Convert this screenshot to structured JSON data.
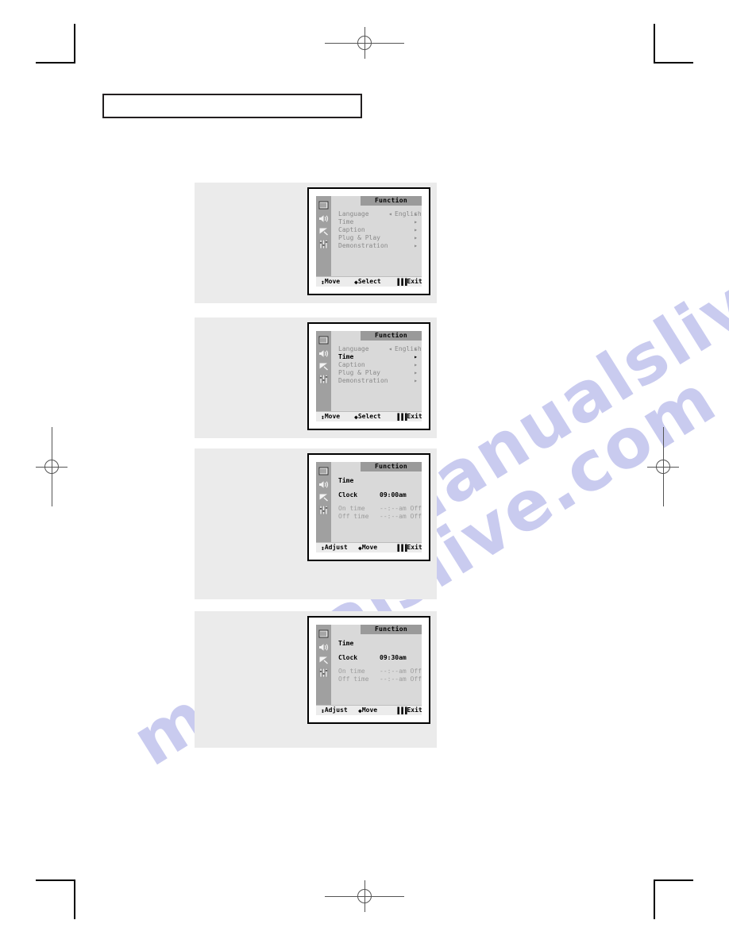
{
  "page": {
    "caption_box_text": "",
    "watermark": "manualslive.com"
  },
  "icons": {
    "picture": "picture-icon",
    "sound": "sound-speaker-icon",
    "channel": "channel-antenna-icon",
    "function": "function-sliders-icon"
  },
  "figures": [
    {
      "id": "fig-1",
      "title": "Function",
      "rows": [
        {
          "label": "Language",
          "value": "English",
          "left_arrow": "◂",
          "right_arrow": "▸",
          "state": "normal"
        },
        {
          "label": "Time",
          "value": "",
          "left_arrow": "",
          "right_arrow": "▸",
          "state": "normal"
        },
        {
          "label": "Caption",
          "value": "",
          "left_arrow": "",
          "right_arrow": "▸",
          "state": "normal"
        },
        {
          "label": "Plug & Play",
          "value": "",
          "left_arrow": "",
          "right_arrow": "▸",
          "state": "normal"
        },
        {
          "label": "Demonstration",
          "value": "",
          "left_arrow": "",
          "right_arrow": "▸",
          "state": "normal"
        }
      ],
      "footer": [
        {
          "glyph": "↕",
          "label": "Move"
        },
        {
          "glyph": "◆",
          "label": "Select"
        },
        {
          "glyph": "▐▐▐",
          "label": "Exit"
        }
      ]
    },
    {
      "id": "fig-2",
      "title": "Function",
      "rows": [
        {
          "label": "Language",
          "value": "English",
          "left_arrow": "◂",
          "right_arrow": "▸",
          "state": "normal"
        },
        {
          "label": "Time",
          "value": "",
          "left_arrow": "",
          "right_arrow": "▸",
          "state": "active"
        },
        {
          "label": "Caption",
          "value": "",
          "left_arrow": "",
          "right_arrow": "▸",
          "state": "normal"
        },
        {
          "label": "Plug & Play",
          "value": "",
          "left_arrow": "",
          "right_arrow": "▸",
          "state": "normal"
        },
        {
          "label": "Demonstration",
          "value": "",
          "left_arrow": "",
          "right_arrow": "▸",
          "state": "normal"
        }
      ],
      "footer": [
        {
          "glyph": "↕",
          "label": "Move"
        },
        {
          "glyph": "◆",
          "label": "Select"
        },
        {
          "glyph": "▐▐▐",
          "label": "Exit"
        }
      ]
    },
    {
      "id": "fig-3",
      "title": "Function",
      "rows": [
        {
          "label": "Time",
          "value": "",
          "left_arrow": "",
          "right_arrow": "",
          "state": "active"
        },
        {
          "label": "Clock",
          "value": "09:00am",
          "left_arrow": "",
          "right_arrow": "",
          "state": "active"
        },
        {
          "label": "On time",
          "value": "--:--am Off",
          "left_arrow": "",
          "right_arrow": "",
          "state": "dim"
        },
        {
          "label": "Off time",
          "value": "--:--am Off",
          "left_arrow": "",
          "right_arrow": "",
          "state": "dim"
        }
      ],
      "footer": [
        {
          "glyph": "↕",
          "label": "Adjust"
        },
        {
          "glyph": "◆",
          "label": "Move"
        },
        {
          "glyph": "▐▐▐",
          "label": "Exit"
        }
      ]
    },
    {
      "id": "fig-4",
      "title": "Function",
      "rows": [
        {
          "label": "Time",
          "value": "",
          "left_arrow": "",
          "right_arrow": "",
          "state": "active"
        },
        {
          "label": "Clock",
          "value": "09:30am",
          "left_arrow": "",
          "right_arrow": "",
          "state": "active"
        },
        {
          "label": "On time",
          "value": "--:--am Off",
          "left_arrow": "",
          "right_arrow": "",
          "state": "dim"
        },
        {
          "label": "Off time",
          "value": "--:--am Off",
          "left_arrow": "",
          "right_arrow": "",
          "state": "dim"
        }
      ],
      "footer": [
        {
          "glyph": "↕",
          "label": "Adjust"
        },
        {
          "glyph": "◆",
          "label": "Move"
        },
        {
          "glyph": "▐▐▐",
          "label": "Exit"
        }
      ]
    }
  ],
  "colors": {
    "page_bg": "#ffffff",
    "figure_bg": "#ebebeb",
    "osd_screen": "#d9d9d9",
    "icon_column": "#a0a0a0",
    "title_bar": "#9a9a9a",
    "footer_bar": "#ececec",
    "dim_text": "#9d9d9d",
    "active_text": "#111111",
    "watermark": "#c9cbef",
    "rule": "#231f20"
  }
}
